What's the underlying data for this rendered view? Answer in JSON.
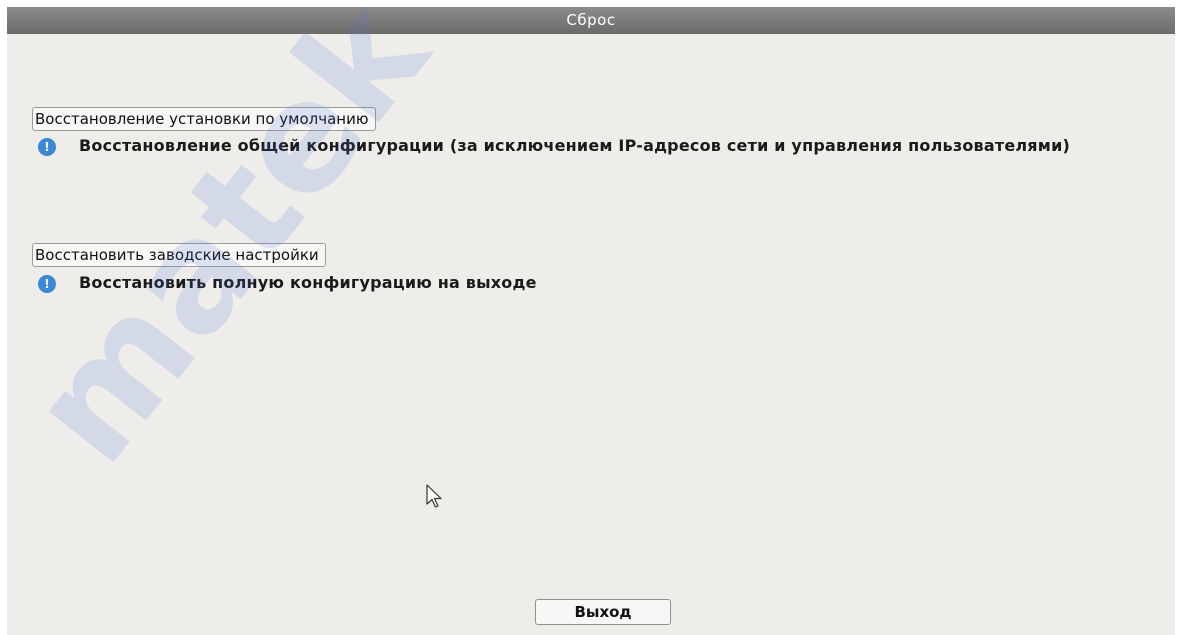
{
  "window": {
    "title": "Сброс"
  },
  "sections": [
    {
      "label": "Восстановление установки по умолчанию",
      "description": "Восстановление общей конфигурации (за исключением IP-адресов сети и управления пользователями)",
      "icon": "info-icon"
    },
    {
      "label": "Восстановить заводские настройки",
      "description": "Восстановить полную конфигурацию на выходе",
      "icon": "info-icon"
    }
  ],
  "footer": {
    "exit_label": "Выход"
  },
  "watermark": {
    "text": "matek"
  },
  "colors": {
    "title_bar": "#7c7b79",
    "background": "#eeedea",
    "info_icon": "#3c88d6",
    "watermark": "#506edc"
  }
}
